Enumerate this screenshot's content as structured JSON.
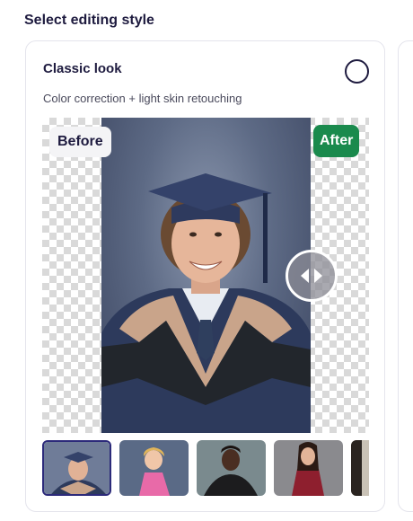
{
  "section": {
    "title": "Select editing style"
  },
  "option": {
    "title": "Classic look",
    "description": "Color correction + light skin retouching",
    "selected": false
  },
  "compare": {
    "before_label": "Before",
    "after_label": "After",
    "handle_icon": "left-right-arrows-icon"
  },
  "colors": {
    "after_badge": "#1a8a4d",
    "radio_border": "#1e1b3f",
    "title_text": "#1e1b3f"
  },
  "thumbnails": [
    {
      "name": "graduate-thumbnail",
      "selected": true
    },
    {
      "name": "child-pink-dress-thumbnail",
      "selected": false
    },
    {
      "name": "man-black-jacket-thumbnail",
      "selected": false
    },
    {
      "name": "woman-red-dress-thumbnail",
      "selected": false
    },
    {
      "name": "partial-thumbnail",
      "selected": false
    }
  ]
}
